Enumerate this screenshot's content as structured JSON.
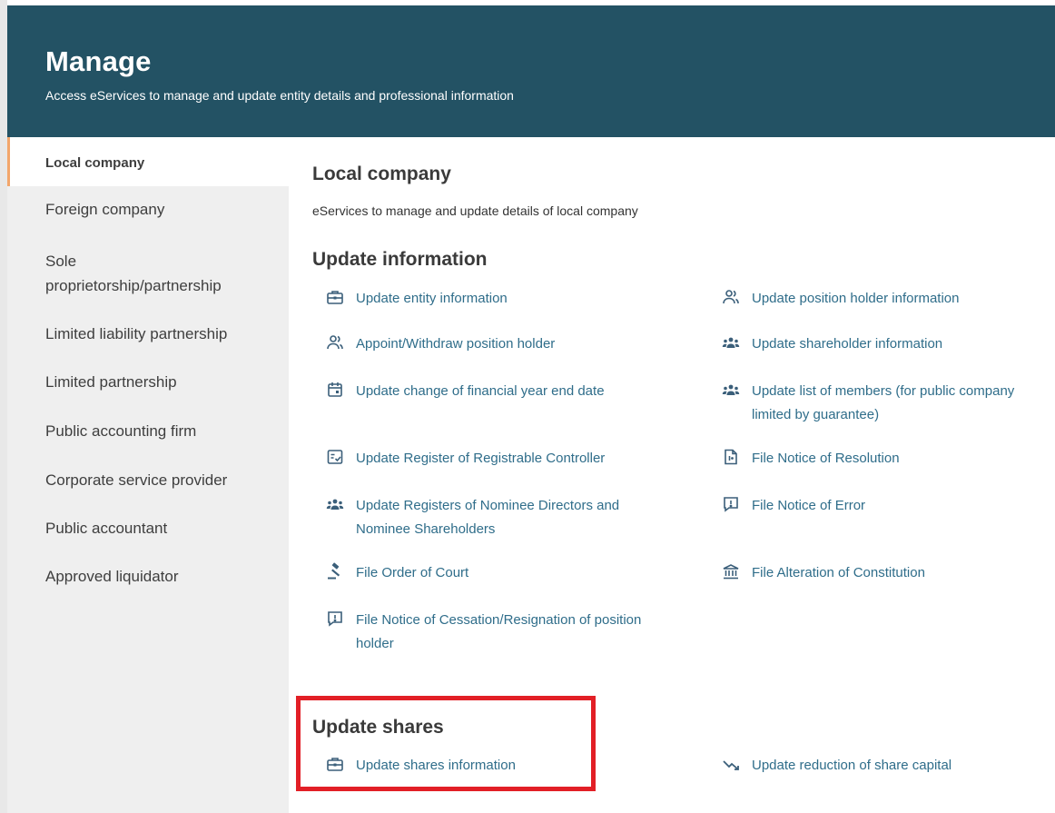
{
  "header": {
    "title": "Manage",
    "subtitle": "Access eServices to manage and update entity details and professional information"
  },
  "sidebar": {
    "items": [
      {
        "label": "Local company",
        "active": true
      },
      {
        "label": "Foreign company"
      },
      {
        "label": "Sole\nproprietorship/partnership"
      },
      {
        "label": "Limited liability partnership"
      },
      {
        "label": "Limited partnership"
      },
      {
        "label": "Public accounting firm"
      },
      {
        "label": "Corporate service provider"
      },
      {
        "label": "Public accountant"
      },
      {
        "label": "Approved liquidator"
      }
    ]
  },
  "main": {
    "title": "Local company",
    "description": "eServices to manage and update details of local company",
    "update_information": {
      "title": "Update information",
      "links": [
        {
          "label": "Update entity information",
          "icon": "briefcase-icon"
        },
        {
          "label": "Update position holder information",
          "icon": "users-icon"
        },
        {
          "label": "Appoint/Withdraw position holder",
          "icon": "users-icon"
        },
        {
          "label": "Update shareholder information",
          "icon": "group-icon"
        },
        {
          "label": "Update change of financial year end date",
          "icon": "calendar-icon"
        },
        {
          "label": "Update list of members (for public company\nlimited by guarantee)",
          "icon": "group-icon"
        },
        {
          "label": "Update Register of Registrable Controller",
          "icon": "checklist-icon"
        },
        {
          "label": "File Notice of Resolution",
          "icon": "document-icon"
        },
        {
          "label": "Update Registers of Nominee Directors and\nNominee Shareholders",
          "icon": "group-icon"
        },
        {
          "label": "File Notice of Error",
          "icon": "alert-message-icon"
        },
        {
          "label": "File Order of Court",
          "icon": "gavel-icon"
        },
        {
          "label": "File Alteration of Constitution",
          "icon": "bank-icon"
        },
        {
          "label": "File Notice of Cessation/Resignation of position\nholder",
          "icon": "alert-message-icon"
        }
      ]
    },
    "update_shares": {
      "title": "Update shares",
      "links": [
        {
          "label": "Update shares information",
          "icon": "briefcase-icon"
        },
        {
          "label": "Update reduction of share capital",
          "icon": "trend-down-icon"
        }
      ]
    }
  },
  "colors": {
    "header_bg": "#235264",
    "sidebar_bg": "#efefef",
    "active_indicator": "#f3a66b",
    "link_text": "#2f6d8a",
    "highlight_border": "#e21f26"
  }
}
